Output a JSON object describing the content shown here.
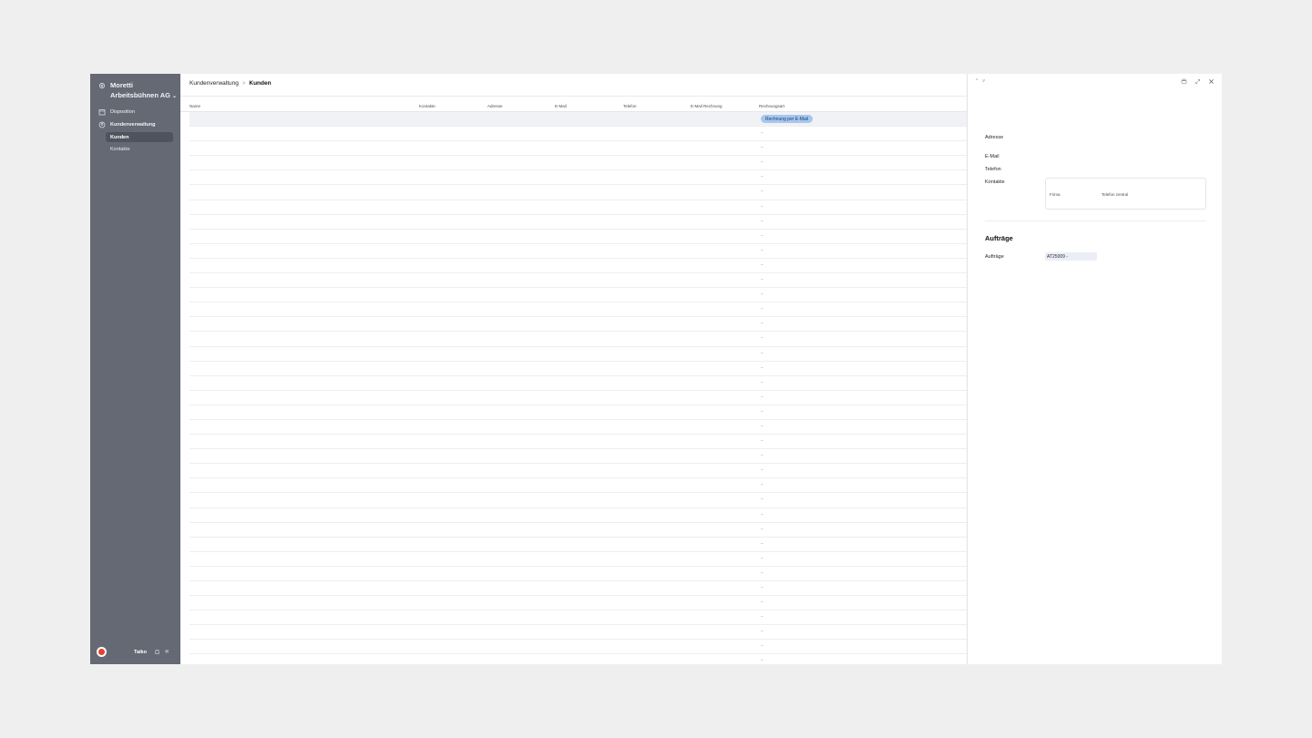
{
  "sidebar": {
    "org_line1": "Moretti",
    "org_line2": "Arbeitsbühnen AG",
    "nav": [
      {
        "label": "Disposition",
        "icon": "calendar-icon"
      },
      {
        "label": "Kundenverwaltung",
        "icon": "users-icon"
      }
    ],
    "subnav": [
      {
        "label": "Kunden",
        "active": true
      },
      {
        "label": "Kontakte",
        "active": false
      }
    ],
    "user_name": "Taiko"
  },
  "breadcrumb": {
    "parent": "Kundenverwaltung",
    "separator": ">",
    "current": "Kunden"
  },
  "table": {
    "columns": [
      "Name",
      "Kontakte",
      "Adresse",
      "E-Mail",
      "Telefon",
      "E-Mail Rechnung",
      "Rechnungsart"
    ],
    "first_row_badge": "Rechnung per E-Mail",
    "empty_value": "–",
    "row_count": 38
  },
  "panel": {
    "nav_prev": "^",
    "nav_next": "v",
    "fields": {
      "adresse": "Adresse",
      "email": "E-Mail",
      "telefon": "Telefon",
      "kontakte": "Kontakte"
    },
    "contacts_headers": [
      "Firma",
      "Telefon zentral"
    ],
    "section_title": "Aufträge",
    "orders_label": "Aufträge",
    "order_value": "AT25009 -"
  },
  "colors": {
    "sidebar_bg": "#656974",
    "badge_bg": "#a8c7f0"
  }
}
